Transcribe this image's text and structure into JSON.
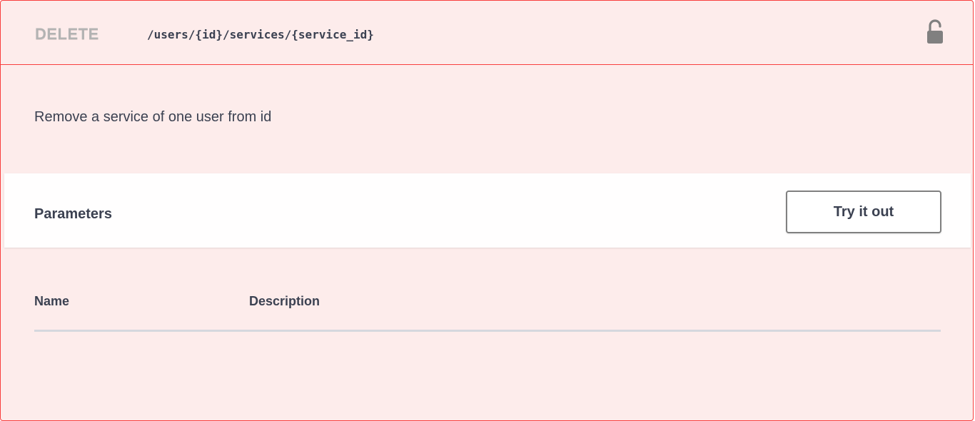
{
  "operation": {
    "method": "DELETE",
    "path": "/users/{id}/services/{service_id}",
    "lock_icon": "unlocked-padlock-icon",
    "description": "Remove a service of one user from id"
  },
  "parameters": {
    "title": "Parameters",
    "try_button_label": "Try it out",
    "columns": [
      "Name",
      "Description"
    ]
  },
  "colors": {
    "accent": "#f93e3e",
    "block_background": "#fdeceb",
    "text": "#3b4151",
    "method_text": "#b3b3b3"
  }
}
